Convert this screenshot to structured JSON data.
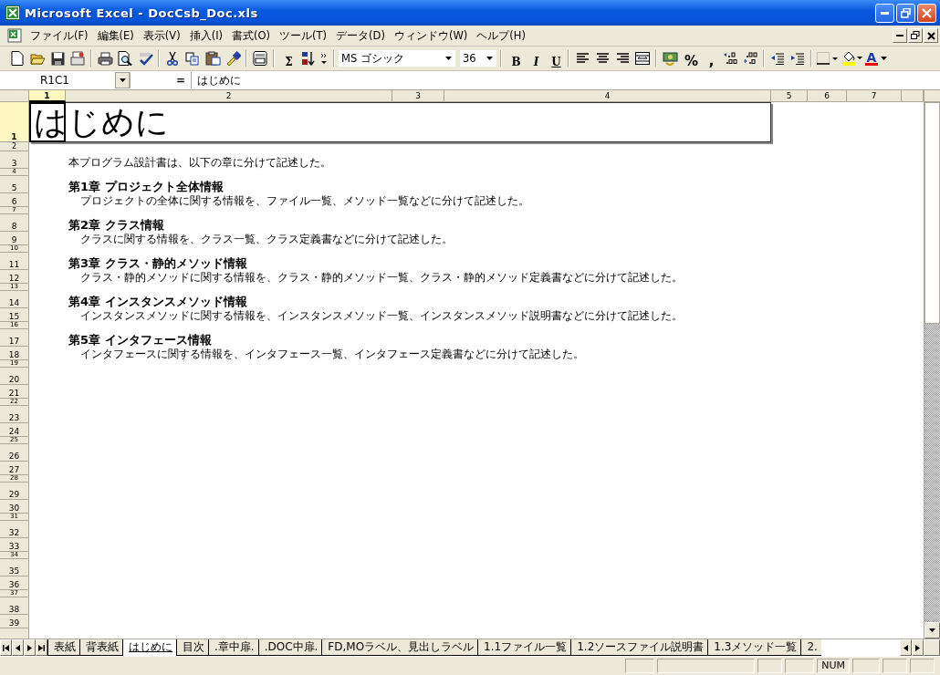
{
  "window": {
    "title": "Microsoft Excel - DocCsb_Doc.xls"
  },
  "menu": [
    "ファイル(F)",
    "編集(E)",
    "表示(V)",
    "挿入(I)",
    "書式(O)",
    "ツール(T)",
    "データ(D)",
    "ウィンドウ(W)",
    "ヘルプ(H)"
  ],
  "toolbar": {
    "sum": "Σ",
    "font": "MS ゴシック",
    "size": "36",
    "bold": "B",
    "italic": "I",
    "underline": "U",
    "percent": "%",
    "comma": ",",
    "font_color": "A"
  },
  "formula_bar": {
    "name_box": "R1C1",
    "equals": "=",
    "value": "はじめに"
  },
  "columns": [
    {
      "label": "1",
      "selected": true
    },
    {
      "label": "2",
      "selected": false
    },
    {
      "label": "3",
      "selected": false
    },
    {
      "label": "4",
      "selected": false
    },
    {
      "label": "5",
      "selected": false
    },
    {
      "label": "6",
      "selected": false
    },
    {
      "label": "7",
      "selected": false
    }
  ],
  "rows": [
    {
      "label": "1",
      "kind": "title",
      "selected": true
    },
    {
      "label": "2",
      "kind": "gap",
      "selected": false
    },
    {
      "label": "3",
      "kind": "large",
      "selected": false
    },
    {
      "label": "4",
      "kind": "small",
      "selected": false
    },
    {
      "label": "5",
      "kind": "large",
      "selected": false
    },
    {
      "label": "6",
      "kind": "medium",
      "selected": false
    },
    {
      "label": "7",
      "kind": "small",
      "selected": false
    },
    {
      "label": "8",
      "kind": "large",
      "selected": false
    },
    {
      "label": "9",
      "kind": "medium",
      "selected": false
    },
    {
      "label": "10",
      "kind": "small",
      "selected": false
    },
    {
      "label": "11",
      "kind": "large",
      "selected": false
    },
    {
      "label": "12",
      "kind": "medium",
      "selected": false
    },
    {
      "label": "13",
      "kind": "small",
      "selected": false
    },
    {
      "label": "14",
      "kind": "large",
      "selected": false
    },
    {
      "label": "15",
      "kind": "medium",
      "selected": false
    },
    {
      "label": "16",
      "kind": "small",
      "selected": false
    },
    {
      "label": "17",
      "kind": "large",
      "selected": false
    },
    {
      "label": "18",
      "kind": "medium",
      "selected": false
    },
    {
      "label": "19",
      "kind": "small",
      "selected": false
    },
    {
      "label": "20",
      "kind": "large",
      "selected": false
    },
    {
      "label": "21",
      "kind": "medium",
      "selected": false
    },
    {
      "label": "22",
      "kind": "small",
      "selected": false
    },
    {
      "label": "23",
      "kind": "large",
      "selected": false
    },
    {
      "label": "24",
      "kind": "medium",
      "selected": false
    },
    {
      "label": "25",
      "kind": "small",
      "selected": false
    },
    {
      "label": "26",
      "kind": "large",
      "selected": false
    },
    {
      "label": "27",
      "kind": "medium",
      "selected": false
    },
    {
      "label": "28",
      "kind": "small",
      "selected": false
    },
    {
      "label": "29",
      "kind": "large",
      "selected": false
    },
    {
      "label": "30",
      "kind": "medium",
      "selected": false
    },
    {
      "label": "31",
      "kind": "small",
      "selected": false
    },
    {
      "label": "32",
      "kind": "large",
      "selected": false
    },
    {
      "label": "33",
      "kind": "medium",
      "selected": false
    },
    {
      "label": "34",
      "kind": "small",
      "selected": false
    },
    {
      "label": "35",
      "kind": "large",
      "selected": false
    },
    {
      "label": "36",
      "kind": "medium",
      "selected": false
    },
    {
      "label": "37",
      "kind": "small",
      "selected": false
    },
    {
      "label": "38",
      "kind": "large",
      "selected": false
    },
    {
      "label": "39",
      "kind": "medium",
      "selected": false
    }
  ],
  "sheet": {
    "title": "はじめに",
    "intro": "本プログラム設計書は、以下の章に分けて記述した。",
    "chapters": [
      {
        "heading": "第1章  プロジェクト全体情報",
        "description": "プロジェクトの全体に関する情報を、ファイル一覧、メソッド一覧などに分けて記述した。"
      },
      {
        "heading": "第2章  クラス情報",
        "description": "クラスに関する情報を、クラス一覧、クラス定義書などに分けて記述した。"
      },
      {
        "heading": "第3章  クラス・静的メソッド情報",
        "description": "クラス・静的メソッドに関する情報を、クラス・静的メソッド一覧、クラス・静的メソッド定義書などに分けて記述した。"
      },
      {
        "heading": "第4章  インスタンスメソッド情報",
        "description": "インスタンスメソッドに関する情報を、インスタンスメソッド一覧、インスタンスメソッド説明書などに分けて記述した。"
      },
      {
        "heading": "第5章  インタフェース情報",
        "description": "インタフェースに関する情報を、インタフェース一覧、インタフェース定義書などに分けて記述した。"
      }
    ]
  },
  "sheet_tabs": [
    {
      "label": "表紙",
      "selected": false
    },
    {
      "label": "背表紙",
      "selected": false
    },
    {
      "label": "はじめに",
      "selected": true
    },
    {
      "label": "目次",
      "selected": false
    },
    {
      "label": ".章中扉.",
      "selected": false
    },
    {
      "label": ".DOC中扉.",
      "selected": false
    },
    {
      "label": "FD,MOラベル、見出しラベル",
      "selected": false
    },
    {
      "label": "1.1ファイル一覧",
      "selected": false
    },
    {
      "label": "1.2ソースファイル説明書",
      "selected": false
    },
    {
      "label": "1.3メソッド一覧",
      "selected": false
    },
    {
      "label": "2.",
      "selected": false
    }
  ],
  "status_bar": {
    "num": "NUM"
  }
}
